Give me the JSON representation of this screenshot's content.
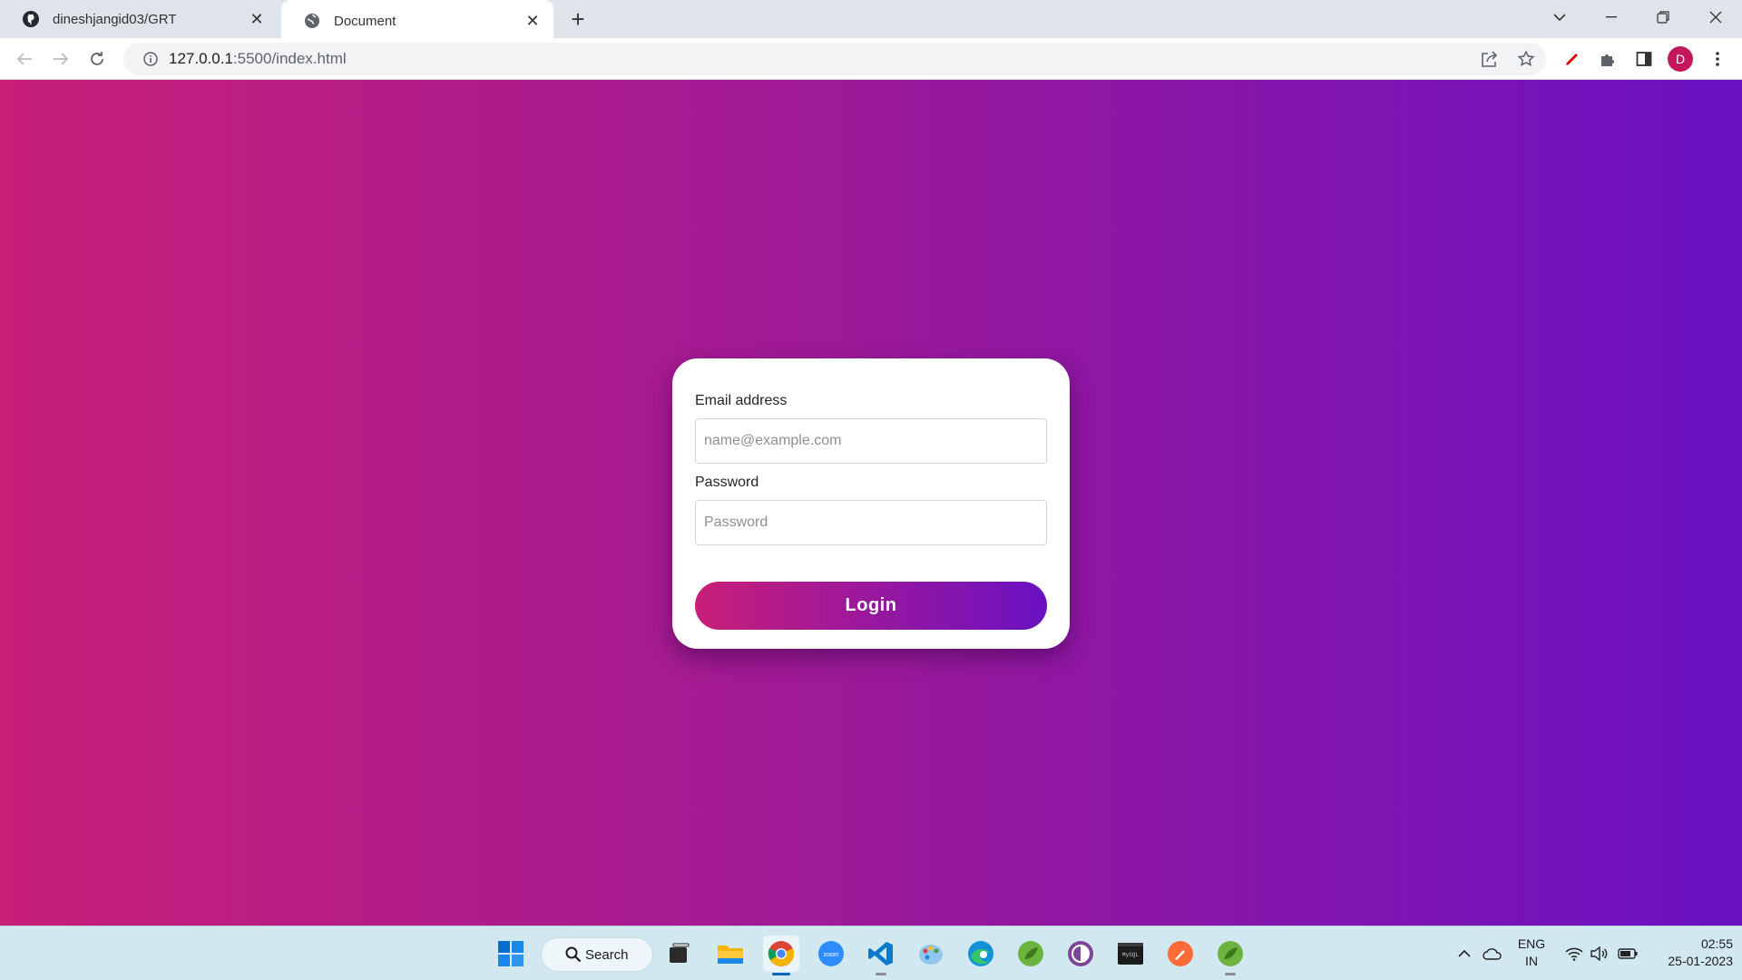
{
  "browser": {
    "tabs": [
      {
        "title": "dineshjangid03/GRT",
        "icon": "github-icon",
        "active": false
      },
      {
        "title": "Document",
        "icon": "globe-icon",
        "active": true
      }
    ],
    "url_host": "127.0.0.1",
    "url_path": ":5500/index.html",
    "profile_initial": "D"
  },
  "login_form": {
    "email_label": "Email address",
    "email_placeholder": "name@example.com",
    "email_value": "",
    "password_label": "Password",
    "password_placeholder": "Password",
    "password_value": "",
    "submit_label": "Login"
  },
  "taskbar": {
    "search_label": "Search",
    "apps": [
      "file-explorer-icon",
      "chrome-icon",
      "zoom-icon",
      "vscode-icon",
      "paint-icon",
      "edge-icon",
      "spring-icon",
      "tor-icon",
      "mysql-icon",
      "postman-icon",
      "spring-icon"
    ],
    "lang_line1": "ENG",
    "lang_line2": "IN",
    "time": "02:55",
    "date": "25-01-2023"
  },
  "colors": {
    "gradient_start": "#c81f78",
    "gradient_end": "#6a11c3",
    "avatar": "#c2185b"
  }
}
